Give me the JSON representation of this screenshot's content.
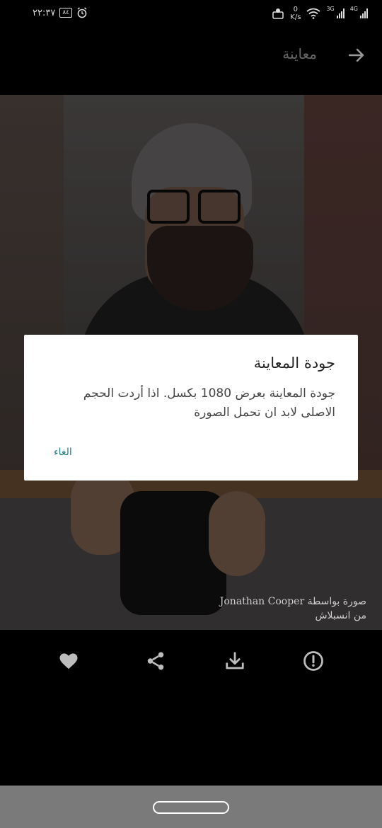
{
  "status_bar": {
    "time": "٢٢:٣٧",
    "battery": "٨٤",
    "speed_value": "0",
    "speed_unit": "K/s",
    "net_1": "3G",
    "net_2": "4G"
  },
  "app_bar": {
    "title": "معاينة",
    "back_icon": "arrow-right-icon"
  },
  "photo": {
    "credit_prefix": "صورة بواسطة",
    "credit_name": "Jonathan Cooper",
    "credit_source": "من انسبلاش"
  },
  "actions": {
    "icons": [
      "heart-icon",
      "share-icon",
      "download-icon",
      "info-icon"
    ]
  },
  "dialog": {
    "title": "جودة المعاينة",
    "body": "جودة المعاينة بعرض 1080 بكسل. اذا أردت الحجم الاصلى لابد ان تحمل الصورة",
    "cancel_label": "الغاء"
  },
  "colors": {
    "accent": "#1e7b80",
    "background": "#000000",
    "dialog": "#ffffff"
  }
}
